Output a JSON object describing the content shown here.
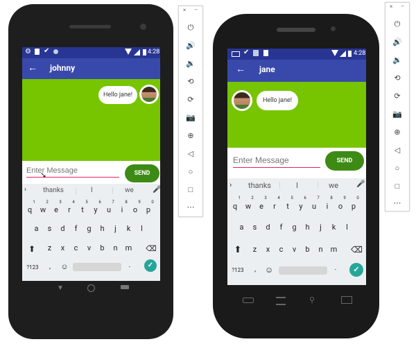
{
  "left_device": {
    "time": "4:28",
    "chat_title": "johnny",
    "back_glyph": "←",
    "message_text": "Hello jane!",
    "input_placeholder": "Enter Message",
    "send_label": "SEND",
    "suggestions": [
      "thanks",
      "I",
      "we"
    ],
    "keyboard": {
      "numbers": [
        "1",
        "2",
        "3",
        "4",
        "5",
        "6",
        "7",
        "8",
        "9",
        "0"
      ],
      "row1": [
        "q",
        "w",
        "e",
        "r",
        "t",
        "y",
        "u",
        "i",
        "o",
        "p"
      ],
      "row2": [
        "a",
        "s",
        "d",
        "f",
        "g",
        "h",
        "j",
        "k",
        "l"
      ],
      "row3": [
        "z",
        "x",
        "c",
        "v",
        "b",
        "n",
        "m"
      ],
      "sym_label": "?123",
      "comma": ",",
      "period": "."
    }
  },
  "right_device": {
    "time": "4:28",
    "chat_title": "jane",
    "back_glyph": "←",
    "message_text": "Hello jane!",
    "input_placeholder": "Enter Message",
    "send_label": "SEND",
    "suggestions": [
      "thanks",
      "I",
      "we"
    ],
    "keyboard": {
      "numbers": [
        "1",
        "2",
        "3",
        "4",
        "5",
        "6",
        "7",
        "8",
        "9",
        "0"
      ],
      "row1": [
        "q",
        "w",
        "e",
        "r",
        "t",
        "y",
        "u",
        "i",
        "o",
        "p"
      ],
      "row2": [
        "a",
        "s",
        "d",
        "f",
        "g",
        "h",
        "j",
        "k",
        "l"
      ],
      "row3": [
        "z",
        "x",
        "c",
        "v",
        "b",
        "n",
        "m"
      ],
      "sym_label": "?123",
      "comma": ",",
      "period": "."
    }
  },
  "emulator_toolbar": {
    "close_glyph": "×",
    "minimize_glyph": "–",
    "icons": [
      "power-icon",
      "volume-up-icon",
      "volume-down-icon",
      "rotate-left-icon",
      "rotate-right-icon",
      "camera-icon",
      "zoom-icon",
      "back-icon",
      "home-icon",
      "overview-icon",
      "more-icon"
    ]
  },
  "colors": {
    "status_bar": "#283593",
    "app_bar": "#3949ab",
    "chat_background": "#76c500",
    "send_button": "#3d8b14",
    "input_underline": "#e91e63",
    "keyboard_enter": "#26a69a"
  }
}
